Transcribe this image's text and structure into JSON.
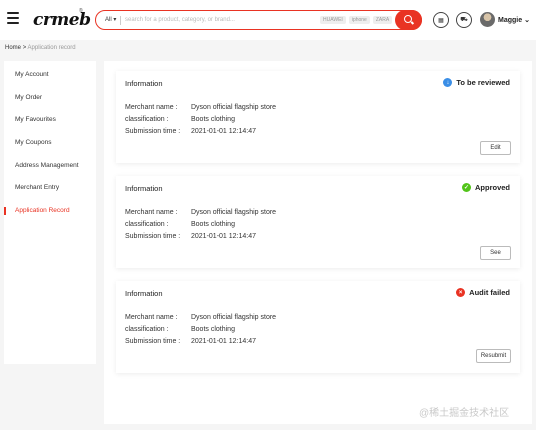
{
  "header": {
    "logo": "crmeb",
    "logo_mark": "®",
    "search": {
      "category": "All",
      "placeholder": "search for a product, category, or brand...",
      "tags": [
        "HUAWEI",
        "iphone",
        "ZARA"
      ]
    },
    "icons": [
      "menu-icon",
      "logo",
      "search-icon",
      "store-icon",
      "cart-icon",
      "avatar"
    ],
    "username": "Maggie"
  },
  "breadcrumb": {
    "home": "Home",
    "sep": ">",
    "current": "Application record"
  },
  "sidebar": {
    "items": [
      {
        "label": "My Account"
      },
      {
        "label": "My Order"
      },
      {
        "label": "My Favourites"
      },
      {
        "label": "My Coupons"
      },
      {
        "label": "Address Management"
      },
      {
        "label": "Merchant Entry"
      },
      {
        "label": "Application Record"
      }
    ],
    "active_index": 6
  },
  "records": [
    {
      "title": "Information",
      "status": "To be reviewed",
      "status_icon": "download-icon",
      "status_color": "#3a8ee6",
      "fields": [
        {
          "label": "Merchant name :",
          "value": "Dyson official flagship store"
        },
        {
          "label": "classification :",
          "value": "Boots clothing"
        },
        {
          "label": "Submission time :",
          "value": "2021-01-01 12:14:47"
        }
      ],
      "button": "Edit"
    },
    {
      "title": "Information",
      "status": "Approved",
      "status_icon": "check-icon",
      "status_color": "#52c41a",
      "fields": [
        {
          "label": "Merchant name :",
          "value": "Dyson official flagship store"
        },
        {
          "label": "classification :",
          "value": "Boots clothing"
        },
        {
          "label": "Submission time :",
          "value": "2021-01-01 12:14:47"
        }
      ],
      "button": "See"
    },
    {
      "title": "Information",
      "status": "Audit failed",
      "status_icon": "close-icon",
      "status_color": "#e93323",
      "fields": [
        {
          "label": "Merchant name :",
          "value": "Dyson official flagship store"
        },
        {
          "label": "classification :",
          "value": "Boots clothing"
        },
        {
          "label": "Submission time :",
          "value": "2021-01-01 12:14:47"
        }
      ],
      "button": "Resubmit"
    }
  ],
  "watermark": "@稀土掘金技术社区",
  "colors": {
    "accent": "#e93323"
  }
}
